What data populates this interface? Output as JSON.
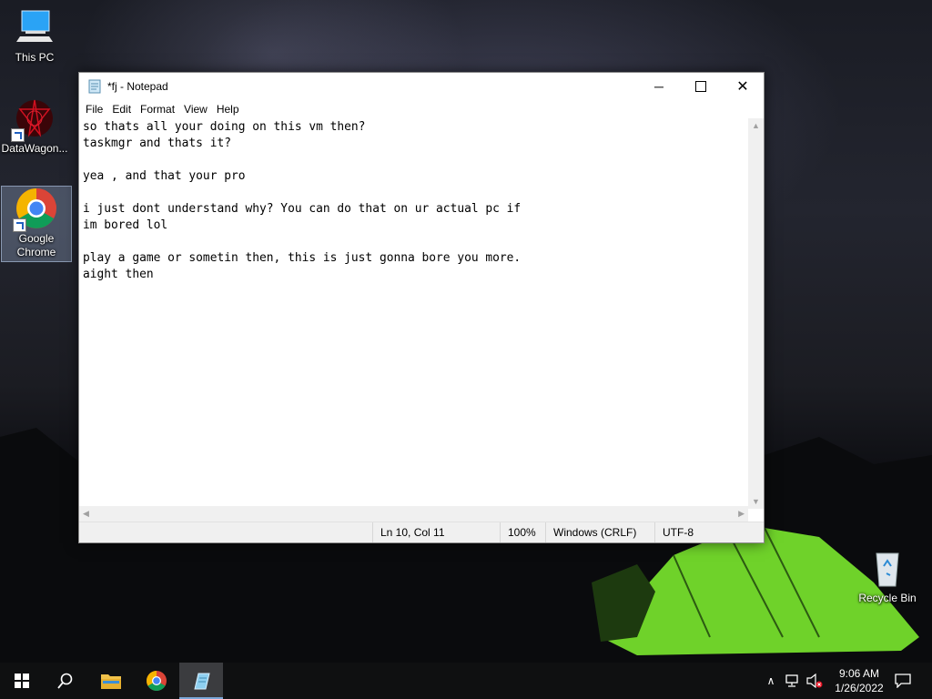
{
  "desktop": {
    "icons": [
      {
        "label": "This PC",
        "icon": "computer-icon"
      },
      {
        "label": "DataWagon...",
        "icon": "datawagon-icon"
      },
      {
        "label": "Google Chrome",
        "icon": "chrome-icon"
      },
      {
        "label": "Recycle Bin",
        "icon": "recycle-bin-icon"
      }
    ]
  },
  "notepad": {
    "title": "*fj - Notepad",
    "menu": [
      "File",
      "Edit",
      "Format",
      "View",
      "Help"
    ],
    "content": "so thats all your doing on this vm then?\ntaskmgr and thats it?\n\nyea , and that your pro\n\ni just dont understand why? You can do that on ur actual pc if\nim bored lol\n\nplay a game or sometin then, this is just gonna bore you more.\naight then",
    "status": {
      "position": "Ln 10, Col 11",
      "zoom": "100%",
      "line_ending": "Windows (CRLF)",
      "encoding": "UTF-8"
    }
  },
  "taskbar": {
    "clock_time": "9:06 AM",
    "clock_date": "1/26/2022",
    "pinned": [
      "start-icon",
      "search-icon",
      "file-explorer-icon",
      "chrome-icon",
      "notepad-icon"
    ]
  },
  "colors": {
    "taskbar_bg": "#0f1011",
    "accent": "#7aa7d8",
    "tent_glow": "#8cff3c"
  }
}
